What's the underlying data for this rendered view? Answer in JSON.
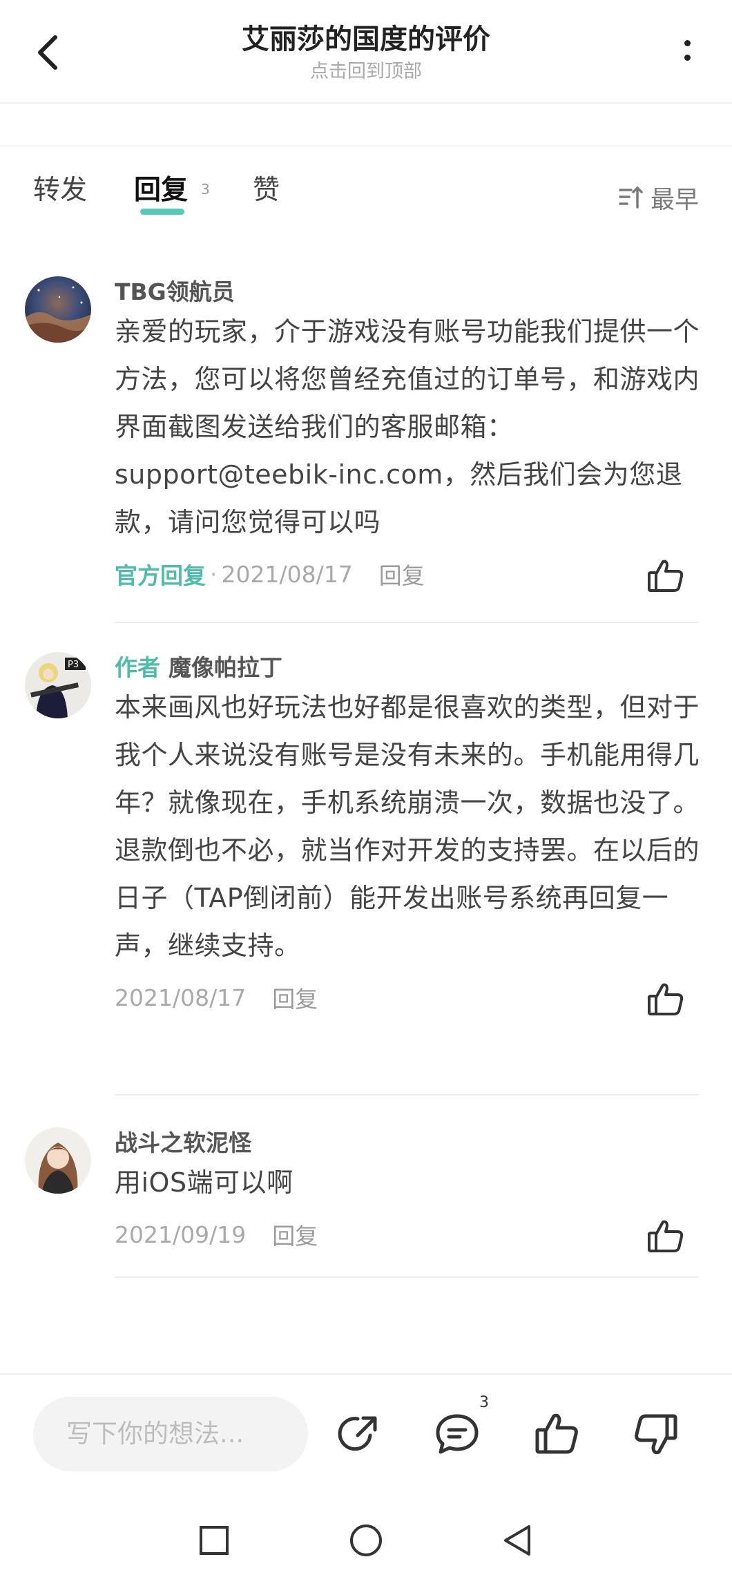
{
  "header": {
    "title": "艾丽莎的国度的评价",
    "subtitle": "点击回到顶部"
  },
  "tabs": {
    "forward": "转发",
    "reply": "回复",
    "reply_count": "3",
    "like": "赞",
    "sort_label": "最早"
  },
  "comments": [
    {
      "author": "TBG领航员",
      "author_tag": "",
      "text": "亲爱的玩家，介于游戏没有账号功能我们提供一个方法，您可以将您曾经充值过的订单号，和游戏内界面截图发送给我们的客服邮箱：support@teebik-inc.com，然后我们会为您退款，请问您觉得可以吗",
      "official_label": "官方回复",
      "date": "2021/08/17",
      "reply_label": "回复"
    },
    {
      "author": "魔像帕拉丁",
      "author_tag": "作者",
      "text": "本来画风也好玩法也好都是很喜欢的类型，但对于我个人来说没有账号是没有未来的。手机能用得几年？就像现在，手机系统崩溃一次，数据也没了。\n退款倒也不必，就当作对开发的支持罢。在以后的日子（TAP倒闭前）能开发出账号系统再回复一声，继续支持。",
      "date": "2021/08/17",
      "reply_label": "回复"
    },
    {
      "author": "战斗之软泥怪",
      "text": "用iOS端可以啊",
      "date": "2021/09/19",
      "reply_label": "回复"
    }
  ],
  "bottom_bar": {
    "input_placeholder": "写下你的想法...",
    "comment_count": "3"
  },
  "colors": {
    "accent": "#57c9b6",
    "text": "#444444",
    "muted": "#a9a9a9"
  }
}
